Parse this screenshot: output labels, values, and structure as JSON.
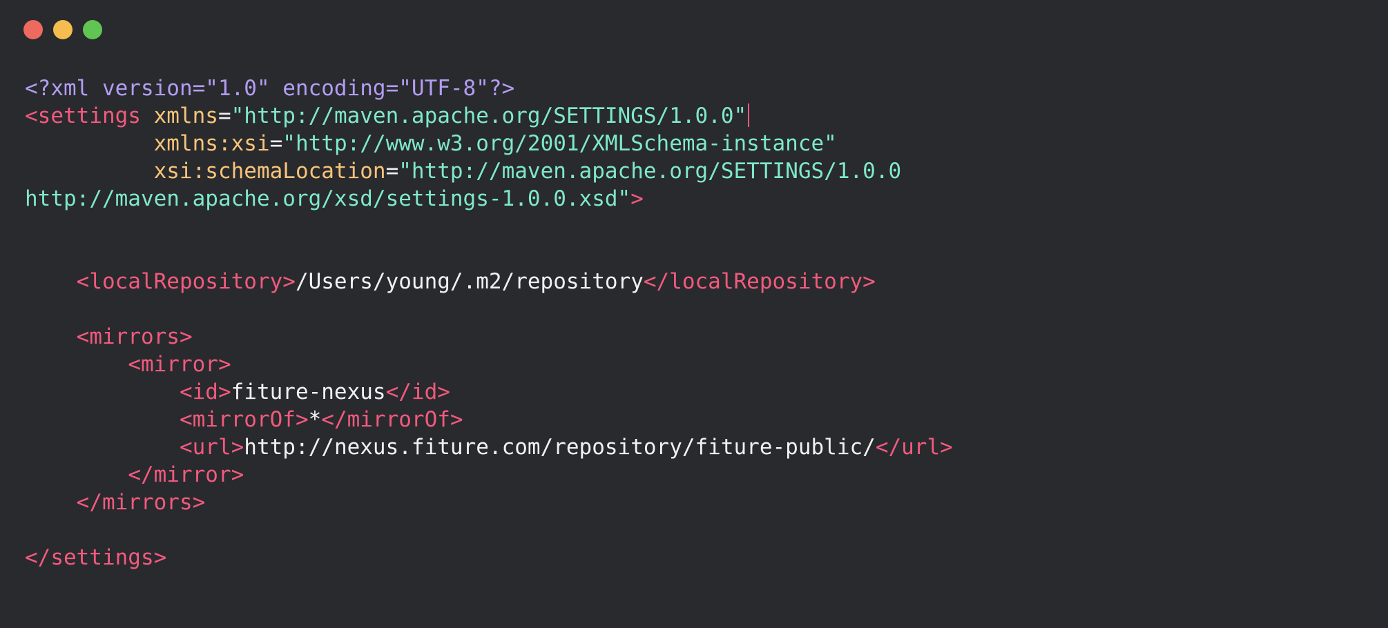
{
  "window": {
    "controls": [
      {
        "name": "close",
        "color": "#ee6a5f"
      },
      {
        "name": "minimize",
        "color": "#f5bd4f"
      },
      {
        "name": "zoom",
        "color": "#61c554"
      }
    ]
  },
  "colors": {
    "background": "#292a2d",
    "prolog": "#b39df3",
    "tag": "#f25a7e",
    "attribute": "#f8c47b",
    "string": "#7ee9c8",
    "text": "#f1f1f1",
    "cursor": "#f25a7e"
  },
  "editor": {
    "lines": [
      [
        {
          "t": "prolog",
          "v": "<?xml version=\"1.0\" encoding=\"UTF-8\"?>"
        }
      ],
      [
        {
          "t": "tag",
          "v": "<settings "
        },
        {
          "t": "attribute",
          "v": "xmlns"
        },
        {
          "t": "text",
          "v": "="
        },
        {
          "t": "string",
          "v": "\"http://maven.apache.org/SETTINGS/1.0.0\""
        },
        {
          "t": "cursor",
          "v": ""
        }
      ],
      [
        {
          "t": "text",
          "v": "          "
        },
        {
          "t": "attribute",
          "v": "xmlns:xsi"
        },
        {
          "t": "text",
          "v": "="
        },
        {
          "t": "string",
          "v": "\"http://www.w3.org/2001/XMLSchema-instance\""
        }
      ],
      [
        {
          "t": "text",
          "v": "          "
        },
        {
          "t": "attribute",
          "v": "xsi:schemaLocation"
        },
        {
          "t": "text",
          "v": "="
        },
        {
          "t": "string",
          "v": "\"http://maven.apache.org/SETTINGS/1.0.0"
        }
      ],
      [
        {
          "t": "string",
          "v": "http://maven.apache.org/xsd/settings-1.0.0.xsd\""
        },
        {
          "t": "tag",
          "v": ">"
        }
      ],
      [],
      [],
      [
        {
          "t": "text",
          "v": "    "
        },
        {
          "t": "tag",
          "v": "<localRepository>"
        },
        {
          "t": "text",
          "v": "/Users/young/.m2/repository"
        },
        {
          "t": "tag",
          "v": "</localRepository>"
        }
      ],
      [],
      [
        {
          "t": "text",
          "v": "    "
        },
        {
          "t": "tag",
          "v": "<mirrors>"
        }
      ],
      [
        {
          "t": "text",
          "v": "        "
        },
        {
          "t": "tag",
          "v": "<mirror>"
        }
      ],
      [
        {
          "t": "text",
          "v": "            "
        },
        {
          "t": "tag",
          "v": "<id>"
        },
        {
          "t": "text",
          "v": "fiture-nexus"
        },
        {
          "t": "tag",
          "v": "</id>"
        }
      ],
      [
        {
          "t": "text",
          "v": "            "
        },
        {
          "t": "tag",
          "v": "<mirrorOf>"
        },
        {
          "t": "text",
          "v": "*"
        },
        {
          "t": "tag",
          "v": "</mirrorOf>"
        }
      ],
      [
        {
          "t": "text",
          "v": "            "
        },
        {
          "t": "tag",
          "v": "<url>"
        },
        {
          "t": "text",
          "v": "http://nexus.fiture.com/repository/fiture-public/"
        },
        {
          "t": "tag",
          "v": "</url>"
        }
      ],
      [
        {
          "t": "text",
          "v": "        "
        },
        {
          "t": "tag",
          "v": "</mirror>"
        }
      ],
      [
        {
          "t": "text",
          "v": "    "
        },
        {
          "t": "tag",
          "v": "</mirrors>"
        }
      ],
      [],
      [
        {
          "t": "tag",
          "v": "</settings>"
        }
      ]
    ]
  }
}
